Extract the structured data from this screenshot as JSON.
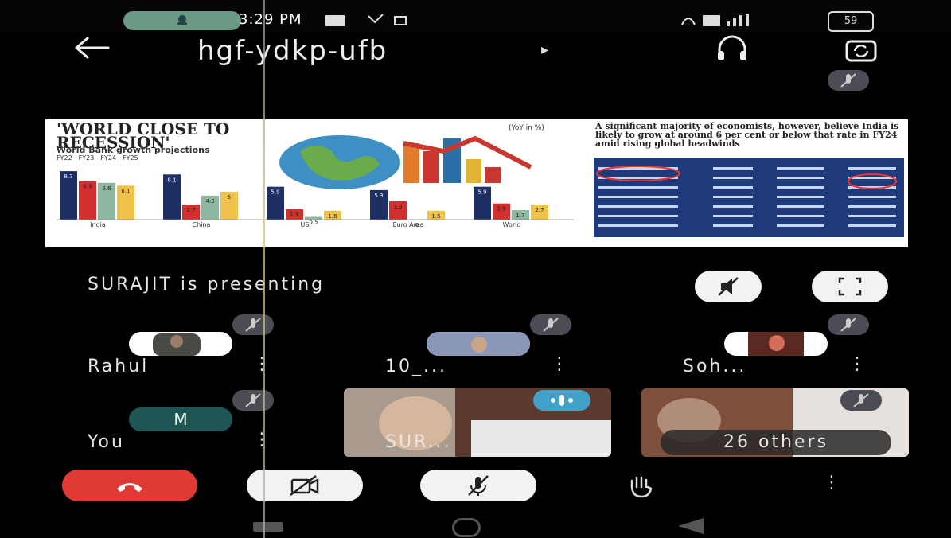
{
  "status_bar": {
    "time": "3:29 PM",
    "battery": "59"
  },
  "toolbar": {
    "meeting_code": "hgf-ydkp-ufb",
    "caret": "▸"
  },
  "shared_screen": {
    "headline": "'WORLD CLOSE TO RECESSION'",
    "subheadline": "World Bank growth projections",
    "unit_note": "(YoY in %)",
    "legend": [
      "FY22",
      "FY23",
      "FY24",
      "FY25"
    ],
    "regions": [
      "India",
      "China",
      "US",
      "Euro Area",
      "World"
    ],
    "right_headline": "A significant majority of economists, however, believe India is likely to grow at around 6 per cent or below that rate in FY24 amid rising global headwinds"
  },
  "chart_data": {
    "type": "bar",
    "title": "'WORLD CLOSE TO RECESSION'",
    "subtitle": "World Bank growth projections",
    "categories": [
      "India",
      "China",
      "US",
      "Euro Area",
      "World"
    ],
    "series": [
      {
        "name": "FY22",
        "color": "#1e2f63",
        "values": [
          8.7,
          8.1,
          5.9,
          5.3,
          5.9
        ]
      },
      {
        "name": "FY23",
        "color": "#d2302e",
        "values": [
          6.9,
          2.7,
          1.9,
          3.3,
          2.9
        ]
      },
      {
        "name": "FY24",
        "color": "#8fb7a0",
        "values": [
          6.6,
          4.3,
          0.5,
          0,
          1.7
        ]
      },
      {
        "name": "FY25",
        "color": "#f0c24a",
        "values": [
          6.1,
          5.0,
          1.6,
          1.6,
          2.7
        ]
      }
    ],
    "value_labels": {
      "India": [
        "8.7",
        "6.9",
        "6.6",
        "6.1"
      ],
      "China": [
        "8.1",
        "2.7",
        "4.3",
        "5"
      ],
      "US": [
        "5.9",
        "1.9",
        "0.5",
        "1.6"
      ],
      "Euro Area": [
        "5.3",
        "3.3",
        "0",
        "1.6"
      ],
      "World": [
        "5.9",
        "2.9",
        "1.7",
        "2.7"
      ]
    },
    "ylim": [
      0,
      10
    ]
  },
  "presenter": {
    "text": "SURAJIT  is presenting"
  },
  "participants": [
    {
      "name": "Rahul"
    },
    {
      "name": "10_..."
    },
    {
      "name": "Soh..."
    },
    {
      "name": "You",
      "initial": "M"
    },
    {
      "name": "SUR..."
    },
    {
      "name": "26 others"
    }
  ],
  "colors": {
    "end_call": "#e13a35",
    "control_bg": "#f2f2f2",
    "mute_chip": "#4c4c54",
    "speaking": "#3fa1c9"
  }
}
